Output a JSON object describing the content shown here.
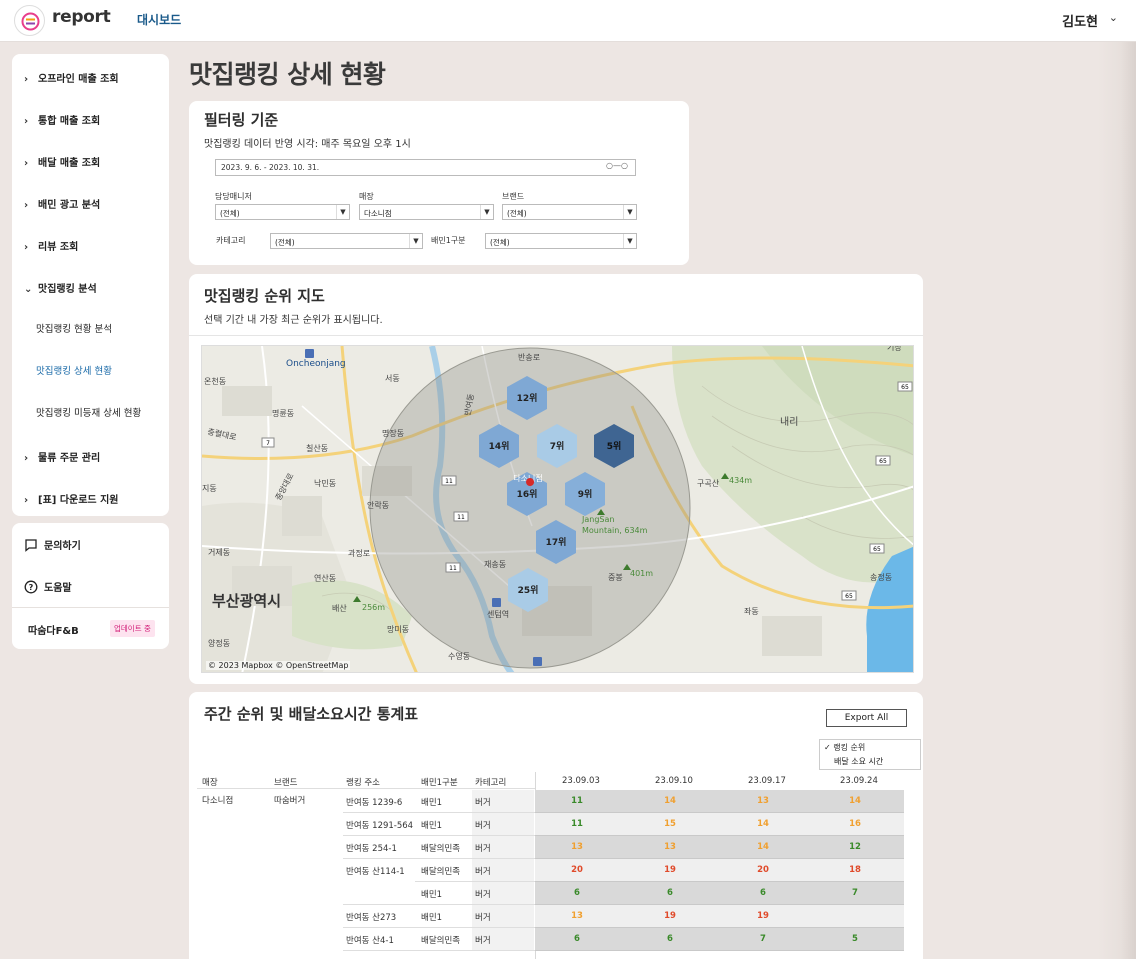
{
  "app": {
    "name": "report",
    "nav_label": "대시보드",
    "user_name": "김도현"
  },
  "sidebar": {
    "items": [
      {
        "label": "오프라인 매출 조회",
        "chevron": "›"
      },
      {
        "label": "통합 매출 조회",
        "chevron": "›"
      },
      {
        "label": "배달 매출 조회",
        "chevron": "›"
      },
      {
        "label": "배민 광고 분석",
        "chevron": "›"
      },
      {
        "label": "리뷰 조회",
        "chevron": "›"
      },
      {
        "label": "맛집랭킹 분석",
        "chevron": "⌄"
      },
      {
        "label": "물류 주문 관리",
        "chevron": "›"
      },
      {
        "label": "[표] 다운로드 지원",
        "chevron": "›"
      }
    ],
    "sub_items": [
      {
        "label": "맛집랭킹 현황 분석"
      },
      {
        "label": "맛집랭킹 상세 현황",
        "active": true
      },
      {
        "label": "맛집랭킹 미등재 상세 현황"
      }
    ],
    "inquiry_label": "문의하기",
    "help_label": "도움말",
    "company_name": "따숨다F&B",
    "update_badge": "업데이트 중"
  },
  "page": {
    "title": "맛집랭킹 상세 현황"
  },
  "filter": {
    "title": "필터링 기준",
    "note": "맛집랭킹 데이터 반영 시각: 매주 목요일 오후 1시",
    "date_range": "2023. 9. 6. - 2023. 10. 31.",
    "date_toggle": "○—○",
    "manager_label": "담당매니저",
    "manager_value": "(전체)",
    "store_label": "매장",
    "store_value": "다소니점",
    "brand_label": "브랜드",
    "brand_value": "(전체)",
    "category_label": "카테고리",
    "category_value": "(전체)",
    "baemin_label": "배민1구분",
    "baemin_value": "(전체)",
    "dropdown_arrow": "▼"
  },
  "map": {
    "title": "맛집랭킹 순위 지도",
    "note": "선택 기간 내 가장 최근 순위가 표시됩니다.",
    "attribution": "© 2023 Mapbox  © OpenStreetMap",
    "city_label": "부산광역시",
    "store_marker_label": "다소니점",
    "hexes": [
      {
        "label": "12위",
        "color": "#7fa8d4"
      },
      {
        "label": "14위",
        "color": "#7fa8d4"
      },
      {
        "label": "7위",
        "color": "#a9cbe6"
      },
      {
        "label": "5위",
        "color": "#3f6592"
      },
      {
        "label": "16위",
        "color": "#7fa8d4"
      },
      {
        "label": "9위",
        "color": "#86afd9"
      },
      {
        "label": "17위",
        "color": "#7fa8d4"
      },
      {
        "label": "25위",
        "color": "#a9cbe6"
      }
    ],
    "place_labels": [
      "반송로",
      "Oncheonjang",
      "온천동",
      "서동",
      "명륜동",
      "명장동",
      "충렬대로",
      "칠산동",
      "낙민동",
      "중앙대로",
      "지동",
      "안락동",
      "거제동",
      "재송동",
      "과정로",
      "연산동",
      "배산",
      "256m",
      "망미동",
      "양정동",
      "수영동",
      "센텀역",
      "내리",
      "구곡산",
      "434m",
      "JangSan",
      "Mountain, 634m",
      "중봉",
      "401m",
      "좌동",
      "송정동",
      "기장",
      "반여동"
    ]
  },
  "table": {
    "title": "주간 순위 및 배달소요시간 통계표",
    "export_label": "Export All",
    "metric_options": [
      "✓ 랭킹 순위",
      "배달 소요 시간"
    ],
    "headers": [
      "매장",
      "브랜드",
      "랭킹 주소",
      "배민1구분",
      "카테고리"
    ],
    "weeks": [
      "23.09.03",
      "23.09.10",
      "23.09.17",
      "23.09.24"
    ],
    "store": "다소니점",
    "brand": "따숨버거",
    "colors": {
      "green": "#3a8a2a",
      "orange": "#f0a030",
      "red": "#e04a2a"
    },
    "rows": [
      {
        "address": "반여동 1239-6",
        "type": "배민1",
        "category": "버거",
        "values": [
          "11",
          "14",
          "13",
          "14"
        ],
        "tones": [
          "green",
          "orange",
          "orange",
          "orange"
        ]
      },
      {
        "address": "반여동 1291-564",
        "type": "배민1",
        "category": "버거",
        "values": [
          "11",
          "15",
          "14",
          "16"
        ],
        "tones": [
          "green",
          "orange",
          "orange",
          "orange"
        ]
      },
      {
        "address": "반여동 254-1",
        "type": "배달의민족",
        "category": "버거",
        "values": [
          "13",
          "13",
          "14",
          "12"
        ],
        "tones": [
          "orange",
          "orange",
          "orange",
          "green"
        ]
      },
      {
        "address": "반여동 산114-1",
        "type": "배달의민족",
        "category": "버거",
        "values": [
          "20",
          "19",
          "20",
          "18"
        ],
        "tones": [
          "red",
          "red",
          "red",
          "red"
        ]
      },
      {
        "address": "",
        "type": "배민1",
        "category": "버거",
        "values": [
          "6",
          "6",
          "6",
          "7"
        ],
        "tones": [
          "green",
          "green",
          "green",
          "green"
        ]
      },
      {
        "address": "반여동 산273",
        "type": "배민1",
        "category": "버거",
        "values": [
          "13",
          "19",
          "19",
          ""
        ],
        "tones": [
          "orange",
          "red",
          "red",
          "green"
        ]
      },
      {
        "address": "반여동 산4-1",
        "type": "배달의민족",
        "category": "버거",
        "values": [
          "6",
          "6",
          "7",
          "5"
        ],
        "tones": [
          "green",
          "green",
          "green",
          "green"
        ]
      }
    ]
  }
}
